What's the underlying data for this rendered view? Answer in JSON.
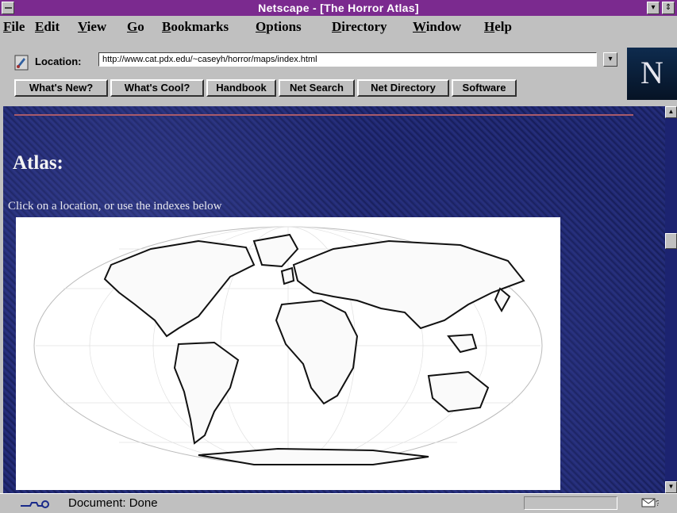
{
  "window": {
    "title": "Netscape - [The Horror Atlas]"
  },
  "titlebar": {
    "minimize": "▾",
    "restore": "⇕"
  },
  "menu": [
    {
      "key": "F",
      "rest": "ile"
    },
    {
      "key": "E",
      "rest": "dit"
    },
    {
      "key": "V",
      "rest": "iew"
    },
    {
      "key": "G",
      "rest": "o"
    },
    {
      "key": "B",
      "rest": "ookmarks"
    },
    {
      "key": "O",
      "rest": "ptions"
    },
    {
      "key": "D",
      "rest": "irectory"
    },
    {
      "key": "W",
      "rest": "indow"
    },
    {
      "key": "H",
      "rest": "elp"
    }
  ],
  "location": {
    "label": "Location:",
    "url": "http://www.cat.pdx.edu/~caseyh/horror/maps/index.html",
    "dropdown_glyph": "▾"
  },
  "directory_buttons": [
    "What's New?",
    "What's Cool?",
    "Handbook",
    "Net Search",
    "Net Directory",
    "Software"
  ],
  "logo": {
    "letter": "N"
  },
  "page": {
    "heading": "Atlas:",
    "instructions": "Click on a location, or use the indexes below"
  },
  "scrollbar": {
    "up": "▲",
    "down": "▼"
  },
  "status": {
    "text": "Document: Done"
  },
  "colors": {
    "titlebar": "#7b2a8f",
    "page_background": "#1c2370",
    "rule": "#a85a6a"
  },
  "icons": [
    "system-menu-icon",
    "location-bookmark-icon",
    "security-key-icon",
    "mail-icon"
  ]
}
